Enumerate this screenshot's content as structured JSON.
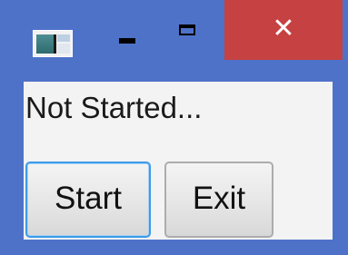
{
  "window": {
    "app_icon": "application-window-icon",
    "controls": {
      "minimize_icon": "minimize-icon",
      "maximize_icon": "maximize-icon",
      "close_glyph": "✕"
    },
    "colors": {
      "frame": "#4f72c9",
      "close_button": "#c64142",
      "client_background": "#f3f3f3",
      "focus_ring": "#3d9be9"
    }
  },
  "content": {
    "status_text": "Not Started...",
    "start_label": "Start",
    "exit_label": "Exit"
  }
}
